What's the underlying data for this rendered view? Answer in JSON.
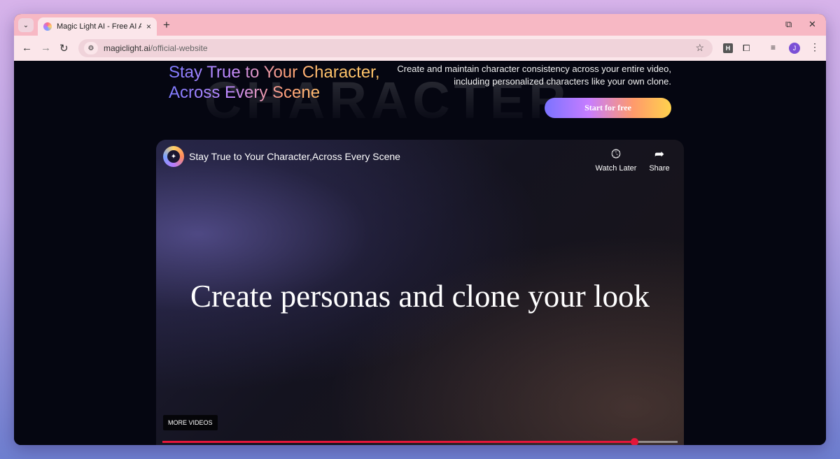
{
  "browser": {
    "tab": {
      "title": "Magic Light AI - Free AI Art Ger",
      "close_icon": "×"
    },
    "new_tab_icon": "+",
    "url": {
      "host": "magiclight.ai",
      "path": "/official-website"
    },
    "profile_initial": "J",
    "extension_label": "H"
  },
  "hero": {
    "headline_line1": "Stay True to Your Character,",
    "headline_line2": "Across Every Scene",
    "background_word": "CHARACTER",
    "description_line1": "Create and maintain character consistency across your entire video,",
    "description_line2": "including personalized characters like your own clone.",
    "cta_label": "Start for free"
  },
  "video": {
    "title": "Stay True to Your Character,Across Every Scene",
    "watch_later_label": "Watch Later",
    "share_label": "Share",
    "caption": "Create personas and clone your look",
    "more_videos_label": "MORE VIDEOS",
    "progress": 0.916
  },
  "colors": {
    "tab_strip": "#f7b8c4",
    "toolbar": "#fbe6ea",
    "page_bg": "#050611",
    "progress": "#e4163a"
  }
}
